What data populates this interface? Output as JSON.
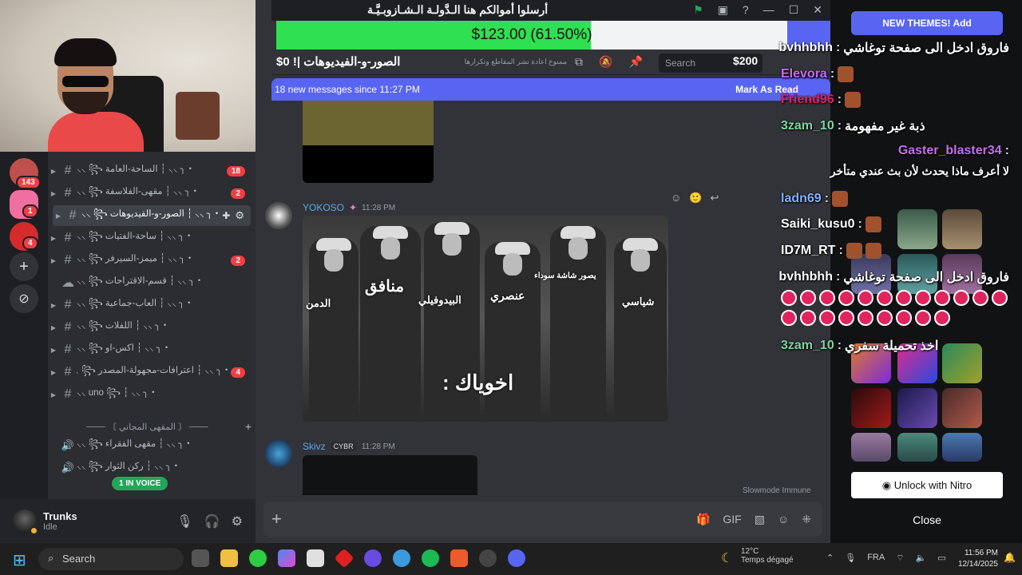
{
  "window": {
    "title": "أرسلوا أموالكم هنا   الـدَّولـة الـشـازوبـيَّـة"
  },
  "donation": {
    "text": "$123.00 (61.50%)",
    "progress": 0.615
  },
  "toolbar": {
    "channel_name": "$0 !| الصور-و-الفيديوهات",
    "topic": "ممنوع اعادة نشر المقاطع وتكرارها",
    "search_placeholder": "Search",
    "amount": "$200"
  },
  "new_messages": {
    "text": "18 new messages since 11:27 PM",
    "mark": "Mark As Read"
  },
  "servers": [
    {
      "badge": "143"
    },
    {
      "badge": "1"
    },
    {
      "badge": "4"
    }
  ],
  "channels": [
    {
      "name": "・╮ ⸝⸝ ┆ الساحة-العامة ꧂ ⸝⸝",
      "badge": "18"
    },
    {
      "name": "・╮ ⸝⸝ ┆ مقهى-الفلاسفة ꧂ ⸝⸝",
      "badge": "2"
    },
    {
      "name": "・╮ ⸝⸝ ┆ الصور-و-الفيديوهات ꧂ ⸝⸝",
      "badge": ""
    },
    {
      "name": "・╮ ⸝⸝ ┆ ساحة-الفتيات ꧂ ⸝⸝",
      "badge": ""
    },
    {
      "name": "・╮ ⸝⸝ ┆ ميمز-السيرفر ꧂ ⸝⸝",
      "badge": "2"
    },
    {
      "name": "・╮ ⸝⸝ ┆ قسم-الاقتراحات ꧂ ⸝⸝",
      "badge": ""
    },
    {
      "name": "・╮ ⸝⸝ ┆ العاب-جماعية ꧂ ⸝⸝",
      "badge": ""
    },
    {
      "name": "・╮ ⸝⸝ ┆ اللفلات ꧂ ⸝⸝",
      "badge": ""
    },
    {
      "name": "・╮ ⸝⸝ ┆ اكس-او ꧂ ⸝⸝",
      "badge": ""
    },
    {
      "name": "・╮ ⸝⸝ ┆ اعترافات-مجهولة-المصدر ꧂ ⸝⸝",
      "badge": "4"
    },
    {
      "name": "・╮ ⸝⸝ ┆ uno ꧂ ⸝⸝",
      "badge": ""
    }
  ],
  "category": {
    "label": "─── 〘 المقهى المجاني 〙 ───"
  },
  "voice_channels": [
    {
      "name": "・╮ ⸝⸝ ┆ مقهى الفقراء ꧂ ⸝⸝"
    },
    {
      "name": "・╮ ⸝⸝ ┆ ركن الثوار ꧂ ⸝⸝"
    }
  ],
  "voice_pill": "1 IN VOICE",
  "user": {
    "name": "Trunks",
    "status": "Idle"
  },
  "messages": [
    {
      "author": "YOKOSO",
      "time": "11:28 PM"
    },
    {
      "author": "Skivz",
      "tag": "CYBR",
      "time": "11:28 PM"
    }
  ],
  "photo_labels": {
    "l1": "الدمن",
    "l2": "منافق",
    "l3": "البيدوفيلي",
    "l4": "عنصري",
    "l5": "يصور شاشة سوداء",
    "l6": "شياسي",
    "caption": "اخوياك :"
  },
  "slowmode": "Slowmode Immune",
  "theme_panel": {
    "new_themes": "NEW THEMES! Add",
    "unlock": "Unlock with Nitro",
    "close": "Close"
  },
  "chat": [
    {
      "user": "bvhhbhh",
      "msg": "فاروق ادخل الى صفحة توغاشي",
      "color": "#ffffff"
    },
    {
      "user": "Elevora",
      "msg": "",
      "color": "#c86cf5"
    },
    {
      "user": "Friend96",
      "msg": "",
      "color": "#e0245e"
    },
    {
      "user": "3zam_10",
      "msg": "ذبة غير مفهومة",
      "color": "#7bd8a0"
    },
    {
      "user": "Gaster_blaster34",
      "msg": "لا أعرف ماذا يحدث لأن بث عندي متأخر",
      "color": "#c86cf5"
    },
    {
      "user": "ladn69",
      "msg": "",
      "color": "#7fb2ff"
    },
    {
      "user": "Saiki_kusu0",
      "msg": "",
      "color": "#ffffff"
    },
    {
      "user": "ID7M_RT",
      "msg": "",
      "color": "#ffffff"
    },
    {
      "user": "bvhhbhh",
      "msg": "فاروق ادخل الى صفحة توغاشي",
      "color": "#ffffff"
    },
    {
      "user": "3zam_10",
      "msg": "اخذ تحميلة سفري",
      "color": "#7bd8a0"
    }
  ],
  "taskbar": {
    "search": "Search",
    "temp": "12°C",
    "weather": "Temps dégagé",
    "lang": "FRA",
    "time": "11:56 PM",
    "date": "12/14/2025"
  }
}
